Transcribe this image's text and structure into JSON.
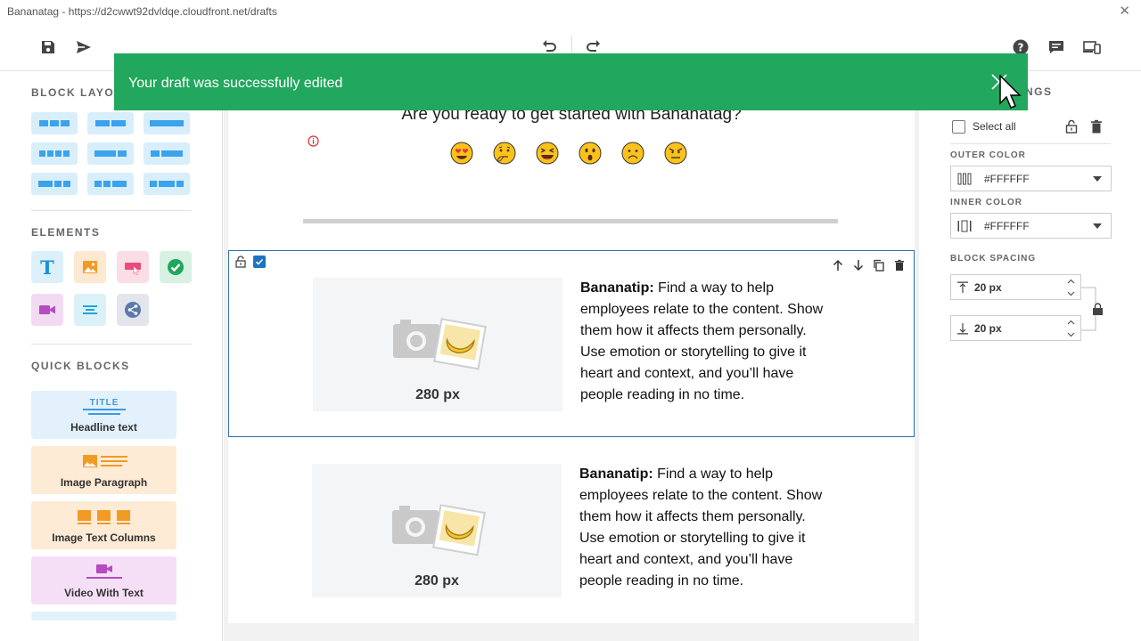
{
  "window": {
    "title": "Bananatag - https://d2cwwt92dvldqe.cloudfront.net/drafts",
    "close_glyph": "✕"
  },
  "toolbar": {
    "icons": [
      "save-icon",
      "send-icon",
      "undo-icon",
      "redo-icon",
      "help-icon",
      "comment-icon",
      "devices-icon"
    ]
  },
  "toast": {
    "message": "Your draft was successfully edited",
    "color": "#22a75e"
  },
  "left_panel": {
    "block_layouts_title": "BLOCK LAYOUTS",
    "elements_title": "ELEMENTS",
    "quick_blocks_title": "QUICK BLOCKS",
    "elements": [
      "text",
      "image",
      "button",
      "check",
      "video",
      "divider",
      "share"
    ],
    "quick_blocks": [
      {
        "label": "Headline text",
        "art_text": "TITLE"
      },
      {
        "label": "Image Paragraph"
      },
      {
        "label": "Image Text Columns"
      },
      {
        "label": "Video With Text"
      }
    ]
  },
  "canvas": {
    "question": "Are you ready to get started with Bananatag?",
    "emojis": [
      "heart-eyes",
      "thinking",
      "laughing",
      "surprised",
      "frowning",
      "angry"
    ],
    "blocks": [
      {
        "image_label": "280 px",
        "tip_bold": "Bananatip:",
        "tip_text": " Find a way to help employees relate to the content. Show them how it affects them personally. Use emotion or storytelling to give it heart and context, and you’ll have people reading in no time."
      },
      {
        "image_label": "280 px",
        "tip_bold": "Bananatip:",
        "tip_text": " Find a way to help employees relate to the content. Show them how it affects them personally. Use emotion or storytelling to give it heart and context, and you’ll have people reading in no time."
      }
    ]
  },
  "right_panel": {
    "heading": "NGS",
    "select_all": "Select all",
    "outer_color_label": "OUTER COLOR",
    "outer_color": "#FFFFFF",
    "inner_color_label": "INNER COLOR",
    "inner_color": "#FFFFFF",
    "block_spacing_label": "BLOCK SPACING",
    "spacing_top": "20 px",
    "spacing_bottom": "20 px"
  }
}
